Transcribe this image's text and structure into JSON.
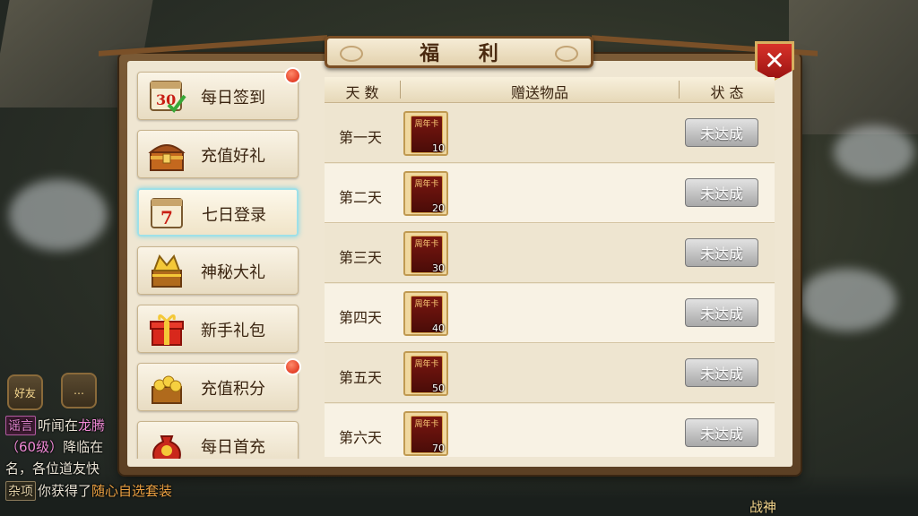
{
  "title": "福 利",
  "close_label": "✕",
  "sidebar": {
    "items": [
      {
        "label": "每日签到",
        "icon": "calendar-30-icon",
        "badge": true
      },
      {
        "label": "充值好礼",
        "icon": "treasure-chest-icon",
        "badge": false
      },
      {
        "label": "七日登录",
        "icon": "calendar-7-icon",
        "badge": false,
        "active": true
      },
      {
        "label": "神秘大礼",
        "icon": "gold-chest-icon",
        "badge": false
      },
      {
        "label": "新手礼包",
        "icon": "gift-box-icon",
        "badge": false
      },
      {
        "label": "充值积分",
        "icon": "gold-coins-chest-icon",
        "badge": true
      },
      {
        "label": "每日首充",
        "icon": "money-bag-icon",
        "badge": false
      }
    ]
  },
  "table": {
    "headers": {
      "day": "天 数",
      "item": "赠送物品",
      "status": "状 态"
    },
    "rows": [
      {
        "day": "第一天",
        "card": "周年卡",
        "qty": "10",
        "status": "未达成"
      },
      {
        "day": "第二天",
        "card": "周年卡",
        "qty": "20",
        "status": "未达成"
      },
      {
        "day": "第三天",
        "card": "周年卡",
        "qty": "30",
        "status": "未达成"
      },
      {
        "day": "第四天",
        "card": "周年卡",
        "qty": "40",
        "status": "未达成"
      },
      {
        "day": "第五天",
        "card": "周年卡",
        "qty": "50",
        "status": "未达成"
      },
      {
        "day": "第六天",
        "card": "周年卡",
        "qty": "70",
        "status": "未达成"
      }
    ]
  },
  "chat": {
    "friend_label": "好友",
    "lines": {
      "l1_tag": "谣言",
      "l1_text": "听闻在",
      "l1_place": "龙腾",
      "l2_level": "（60级）",
      "l2_text": "降临在",
      "l3_text": "名，各位道友快",
      "l4_tag": "杂项",
      "l4_text": "你获得了",
      "l4_item": "随心自选套装"
    },
    "zhanshen": "战神"
  }
}
